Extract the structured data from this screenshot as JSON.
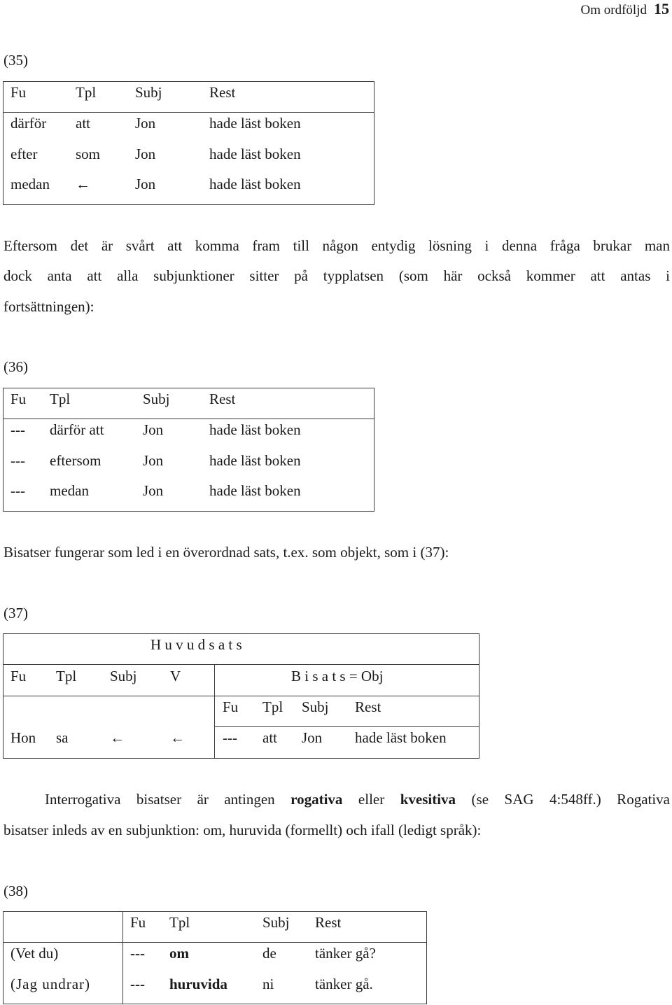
{
  "header": {
    "title": "Om ordföljd",
    "page_number": "15"
  },
  "example35": {
    "label": "(35)",
    "headers": [
      "Fu",
      "Tpl",
      "Subj",
      "Rest"
    ],
    "rows": [
      [
        "därför",
        "att",
        "Jon",
        "hade läst boken"
      ],
      [
        "efter",
        "som",
        "Jon",
        "hade läst boken"
      ],
      [
        "medan",
        "←",
        "Jon",
        "hade läst boken"
      ]
    ]
  },
  "paragraph1": {
    "lines": [
      "Eftersom det är svårt att komma fram till någon entydig lösning i denna fråga brukar man",
      "dock anta att alla subjunktioner sitter på typplatsen (som här också kommer att antas i",
      "fortsättningen):"
    ]
  },
  "example36": {
    "label": "(36)",
    "headers": [
      "Fu",
      "Tpl",
      "Subj",
      "Rest"
    ],
    "rows": [
      [
        "---",
        "därför att",
        "Jon",
        "hade läst boken"
      ],
      [
        "---",
        "eftersom",
        "Jon",
        "hade läst boken"
      ],
      [
        "---",
        "medan",
        "Jon",
        "hade läst boken"
      ]
    ]
  },
  "paragraph2": "Bisatser fungerar som led i en överordnad sats, t.ex. som objekt, som i (37):",
  "example37": {
    "label": "(37)",
    "main_clause_title": "H u v u d s a t s",
    "main_headers": [
      "Fu",
      "Tpl",
      "Subj",
      "V"
    ],
    "sub_clause_title": "B i s a t s = Obj",
    "sub_headers": [
      "Fu",
      "Tpl",
      "Subj",
      "Rest"
    ],
    "main_row": [
      "Hon",
      "sa",
      "←",
      "←"
    ],
    "sub_row": [
      "---",
      "att",
      "Jon",
      "hade läst boken"
    ]
  },
  "paragraph3": {
    "line1_a": "Interrogativa bisatser är antingen ",
    "line1_bold1": "rogativa",
    "line1_b": " eller ",
    "line1_bold2": "kvesitiva",
    "line1_c": " (se SAG 4:548ff.) Rogativa",
    "line2": "bisatser inleds av en subjunktion: om, huruvida (formellt) och ifall (ledigt språk):"
  },
  "example38": {
    "label": "(38)",
    "headers": [
      "Fu",
      "Tpl",
      "Subj",
      "Rest"
    ],
    "rows": [
      {
        "lead": "(Vet du)",
        "fu": "---",
        "tpl": "om",
        "subj": "de",
        "rest": "tänker gå?"
      },
      {
        "lead": "(Jag undrar)",
        "fu": "---",
        "tpl": "huruvida",
        "subj": "ni",
        "rest": "tänker gå."
      }
    ]
  }
}
